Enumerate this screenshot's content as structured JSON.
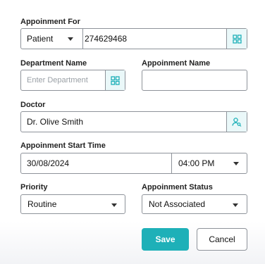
{
  "appointment_for": {
    "label": "Appoinment For",
    "type_value": "Patient",
    "id_value": "274629468",
    "lookup_icon": "grid-lookup-icon"
  },
  "department": {
    "label": "Department Name",
    "placeholder": "Enter Department",
    "lookup_icon": "grid-lookup-icon"
  },
  "appointment_name": {
    "label": "Appoinment Name",
    "value": ""
  },
  "doctor": {
    "label": "Doctor",
    "value": "Dr. Olive Smith",
    "lookup_icon": "user-search-icon"
  },
  "start_time": {
    "label": "Appoinment Start Time",
    "date": "30/08/2024",
    "time": "04:00 PM"
  },
  "priority": {
    "label": "Priority",
    "value": "Routine"
  },
  "status": {
    "label": "Appoinment Status",
    "value": "Not Associated"
  },
  "actions": {
    "save_label": "Save",
    "cancel_label": "Cancel"
  },
  "colors": {
    "accent": "#1eb0b8",
    "icon_bg": "#eaf8f9",
    "border": "#8e939a"
  }
}
